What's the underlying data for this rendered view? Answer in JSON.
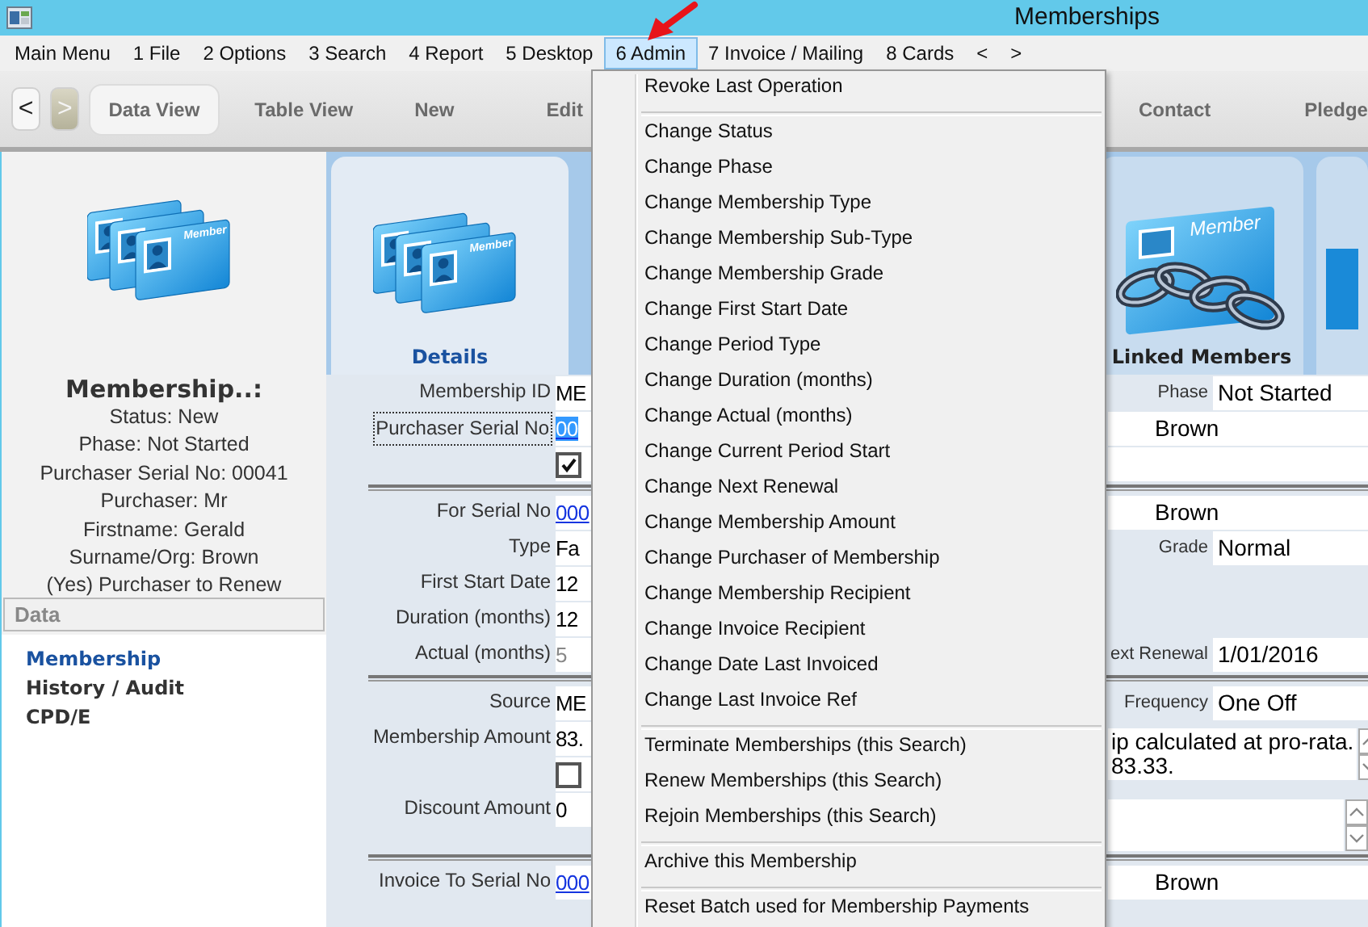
{
  "window": {
    "title": "Memberships"
  },
  "menu_bar": {
    "items": [
      {
        "label": "Main Menu",
        "selected": false
      },
      {
        "label": "1 File",
        "selected": false
      },
      {
        "label": "2 Options",
        "selected": false
      },
      {
        "label": "3 Search",
        "selected": false
      },
      {
        "label": "4 Report",
        "selected": false
      },
      {
        "label": "5 Desktop",
        "selected": false
      },
      {
        "label": "6 Admin",
        "selected": true
      },
      {
        "label": "7 Invoice / Mailing",
        "selected": false
      },
      {
        "label": "8 Cards",
        "selected": false
      },
      {
        "label": "<",
        "selected": false
      },
      {
        "label": ">",
        "selected": false
      }
    ]
  },
  "toolbar": {
    "nav": [
      {
        "label": "<",
        "disabled": false
      },
      {
        "label": ">",
        "disabled": true
      }
    ],
    "views": [
      {
        "label": "Data View",
        "selected": true
      },
      {
        "label": "Table View",
        "selected": false
      }
    ],
    "actions": [
      "New",
      "Edit",
      "Contact",
      "Pledge"
    ]
  },
  "sidebar": {
    "title": "Membership..:",
    "badge_text": "Member",
    "summary": [
      "Status: New",
      "Phase: Not Started",
      "Purchaser Serial No: 00041",
      "Purchaser: Mr",
      "Firstname: Gerald",
      "Surname/Org: Brown",
      "(Yes) Purchaser to Renew"
    ],
    "section": "Data",
    "items": [
      {
        "label": "Membership",
        "selected": true
      },
      {
        "label": "History / Audit",
        "selected": false
      },
      {
        "label": "CPD/E",
        "selected": false
      }
    ]
  },
  "tiles": [
    {
      "label": "Details",
      "kind": "cards",
      "badge_text": "Member",
      "selected": true
    },
    {
      "label": "Linked Members",
      "kind": "chain",
      "badge_text": "Member",
      "selected": false
    }
  ],
  "form": {
    "rows": [
      {
        "kind": "fields",
        "left": {
          "label": "Membership ID",
          "value": "ME",
          "kind": "text"
        },
        "right": {
          "label": "Phase",
          "value": "Not Started",
          "kind": "text"
        }
      },
      {
        "kind": "fields",
        "left": {
          "label": "Purchaser Serial No",
          "value": "00",
          "kind": "link",
          "focused": true
        },
        "right": {
          "value": "Brown",
          "kind": "text"
        }
      },
      {
        "kind": "fields",
        "left": {
          "kind": "checkbox",
          "checked": true
        },
        "right": {
          "kind": "text"
        }
      },
      {
        "kind": "separator"
      },
      {
        "kind": "fields",
        "left": {
          "label": "For Serial No",
          "value": "000",
          "kind": "link",
          "focused": false
        },
        "right": {
          "value": "Brown",
          "kind": "text"
        }
      },
      {
        "kind": "fields",
        "left": {
          "label": "Type",
          "value": "Fa",
          "kind": "text"
        },
        "right": {
          "label": "Grade",
          "value": "Normal",
          "kind": "text"
        }
      },
      {
        "kind": "fields",
        "left": {
          "label": "First Start Date",
          "value": "12",
          "kind": "text"
        }
      },
      {
        "kind": "fields",
        "left": {
          "label": "Duration (months)",
          "value": "12",
          "kind": "text"
        }
      },
      {
        "kind": "fields",
        "left": {
          "label": "Actual (months)",
          "value": "5",
          "kind": "muted"
        },
        "right": {
          "label": "ext Renewal",
          "value": "1/01/2016",
          "kind": "text"
        }
      },
      {
        "kind": "separator"
      },
      {
        "kind": "fields",
        "left": {
          "label": "Source",
          "value": "ME",
          "kind": "text"
        },
        "right": {
          "label": "Frequency",
          "value": "One Off",
          "kind": "text"
        }
      },
      {
        "kind": "fields",
        "left": {
          "label": "Membership Amount",
          "value": "83.",
          "kind": "text"
        },
        "right": {
          "kind": "memo",
          "lines": [
            "ip calculated at pro-rata.",
            "83.33."
          ]
        }
      },
      {
        "kind": "fields",
        "left": {
          "kind": "checkbox",
          "checked": false
        }
      },
      {
        "kind": "fields",
        "left": {
          "label": "Discount Amount",
          "value": "0",
          "kind": "text"
        },
        "right": {
          "kind": "memo"
        }
      },
      {
        "kind": "separator"
      },
      {
        "kind": "fields",
        "left": {
          "label": "Invoice To Serial No",
          "value": "000",
          "kind": "link",
          "focused": false
        },
        "right": {
          "value": "Brown",
          "kind": "text"
        }
      }
    ]
  },
  "dropdown": {
    "groups": [
      [
        "Revoke Last Operation"
      ],
      [
        "Change Status",
        "Change Phase",
        "Change Membership Type",
        "Change Membership Sub-Type",
        "Change Membership Grade",
        "Change First Start Date",
        "Change Period Type",
        "Change Duration (months)",
        "Change Actual (months)",
        "Change Current Period Start",
        "Change Next Renewal",
        "Change Membership Amount",
        "Change Purchaser of Membership",
        "Change Membership Recipient",
        "Change Invoice Recipient",
        "Change Date Last Invoiced",
        "Change Last Invoice Ref"
      ],
      [
        "Terminate Memberships (this Search)",
        "Renew Memberships (this Search)",
        "Rejoin Memberships (this Search)"
      ],
      [
        "Archive this Membership"
      ],
      [
        "Reset Batch used for Membership Payments"
      ]
    ]
  }
}
